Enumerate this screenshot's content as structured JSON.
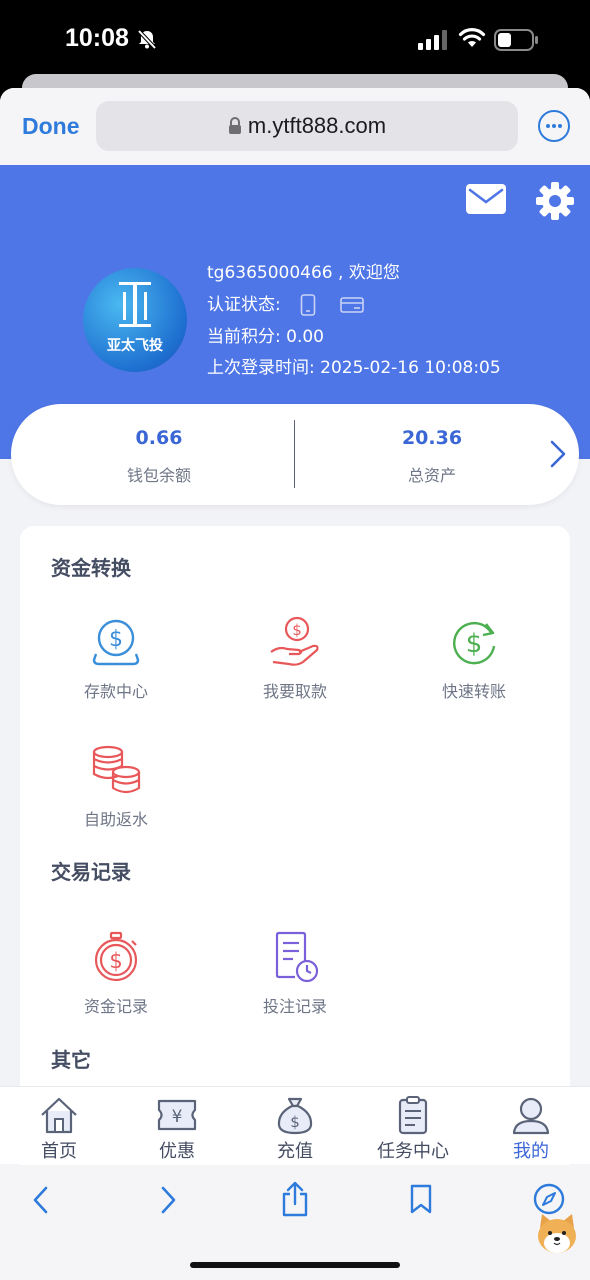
{
  "status_bar": {
    "time": "10:08"
  },
  "browser": {
    "done_label": "Done",
    "url": "m.ytft888.com"
  },
  "profile": {
    "brand_text": "亚太飞投",
    "greeting": "tg6365000466 , 欢迎您",
    "auth_label": "认证状态:",
    "points_label": "当前积分:",
    "points_value": "0.00",
    "last_login_label": "上次登录时间:",
    "last_login_value": "2025-02-16 10:08:05"
  },
  "balance": {
    "wallet_value": "0.66",
    "wallet_label": "钱包余额",
    "total_value": "20.36",
    "total_label": "总资产"
  },
  "sections": [
    {
      "title": "资金转换",
      "items": [
        {
          "label": "存款中心",
          "icon": "deposit-coin-icon",
          "color": "#3b8fd9"
        },
        {
          "label": "我要取款",
          "icon": "withdraw-hand-icon",
          "color": "#e8585a"
        },
        {
          "label": "快速转账",
          "icon": "transfer-dollar-icon",
          "color": "#4caf50"
        },
        {
          "label": "自助返水",
          "icon": "coins-stack-icon",
          "color": "#e8585a"
        }
      ]
    },
    {
      "title": "交易记录",
      "items": [
        {
          "label": "资金记录",
          "icon": "stopwatch-dollar-icon",
          "color": "#e8585a"
        },
        {
          "label": "投注记录",
          "icon": "document-clock-icon",
          "color": "#7b61d9"
        }
      ]
    },
    {
      "title": "其它",
      "items": []
    }
  ],
  "tabbar": [
    {
      "label": "首页",
      "icon": "home-icon"
    },
    {
      "label": "优惠",
      "icon": "coupon-icon"
    },
    {
      "label": "充值",
      "icon": "money-bag-icon"
    },
    {
      "label": "任务中心",
      "icon": "clipboard-icon"
    },
    {
      "label": "我的",
      "icon": "user-icon",
      "active": true
    }
  ],
  "colors": {
    "accent": "#4f76e6",
    "link": "#2f7bdc",
    "text": "#454d63"
  }
}
